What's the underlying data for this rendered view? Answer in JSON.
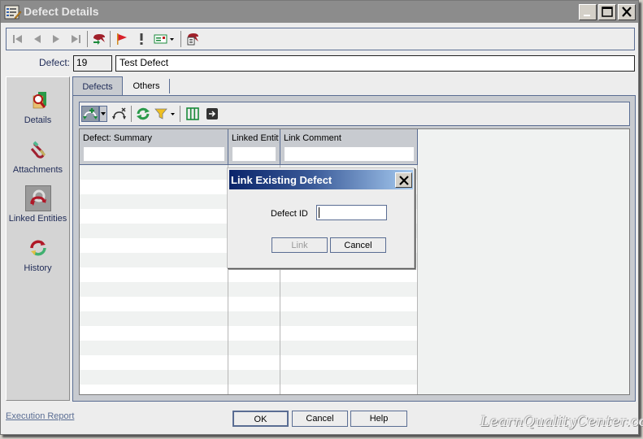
{
  "window": {
    "title": "Defect Details",
    "icon": "defect-details-icon",
    "controls": [
      "minimize",
      "maximize",
      "close"
    ]
  },
  "toolbar": {
    "buttons": [
      {
        "name": "first-record",
        "icon": "first-icon"
      },
      {
        "name": "previous-record",
        "icon": "previous-icon"
      },
      {
        "name": "next-record",
        "icon": "next-icon"
      },
      {
        "name": "last-record",
        "icon": "last-icon"
      },
      {
        "name": "send-by-email",
        "icon": "send-mail-icon"
      },
      {
        "name": "flag-for-follow-up",
        "icon": "flag-icon"
      },
      {
        "name": "highlight",
        "icon": "exclamation-icon"
      },
      {
        "name": "view-options",
        "icon": "view-card-icon"
      },
      {
        "name": "spell-check",
        "icon": "report-icon"
      }
    ]
  },
  "defect": {
    "label": "Defect:",
    "id": "19",
    "name": "Test Defect"
  },
  "sidebar": {
    "items": [
      {
        "label": "Details",
        "icon": "details-icon",
        "active": false
      },
      {
        "label": "Attachments",
        "icon": "attachments-icon",
        "active": false
      },
      {
        "label": "Linked Entities",
        "icon": "linked-entities-icon",
        "active": true
      },
      {
        "label": "History",
        "icon": "history-icon",
        "active": false
      }
    ]
  },
  "tabs": [
    {
      "label": "Defects",
      "active": true
    },
    {
      "label": "Others",
      "active": false
    }
  ],
  "sub_toolbar": {
    "buttons": [
      {
        "name": "link-defect",
        "icon": "link-add-icon",
        "pressed": true
      },
      {
        "name": "link-dropdown",
        "icon": "chevron-down-icon"
      },
      {
        "name": "remove-link",
        "icon": "link-remove-icon"
      },
      {
        "name": "refresh",
        "icon": "refresh-icon"
      },
      {
        "name": "filter",
        "icon": "filter-icon"
      },
      {
        "name": "filter-dropdown",
        "icon": "chevron-down-icon"
      },
      {
        "name": "select-columns",
        "icon": "columns-icon"
      },
      {
        "name": "go-to",
        "icon": "go-to-icon"
      }
    ]
  },
  "grid": {
    "columns": [
      {
        "header": "Defect: Summary",
        "filter": ""
      },
      {
        "header": "Linked Entity",
        "filter": ""
      },
      {
        "header": "Link Comment",
        "filter": ""
      }
    ],
    "rows": []
  },
  "dialog": {
    "title": "Link Existing Defect",
    "field_label": "Defect ID",
    "field_value": "",
    "link_label": "Link",
    "link_enabled": false,
    "cancel_label": "Cancel"
  },
  "footer": {
    "execution_report": "Execution Report",
    "ok": "OK",
    "cancel": "Cancel",
    "help": "Help"
  },
  "watermark": "LearnQualityCenter.com",
  "colors": {
    "accent_border": "#5a6d93",
    "label_text": "#1f2b57",
    "dialog_title_start": "#0a246a",
    "dialog_title_end": "#a6caf0",
    "titlebar": "#8c8c8c",
    "row_alt": "#f0f2f1"
  }
}
